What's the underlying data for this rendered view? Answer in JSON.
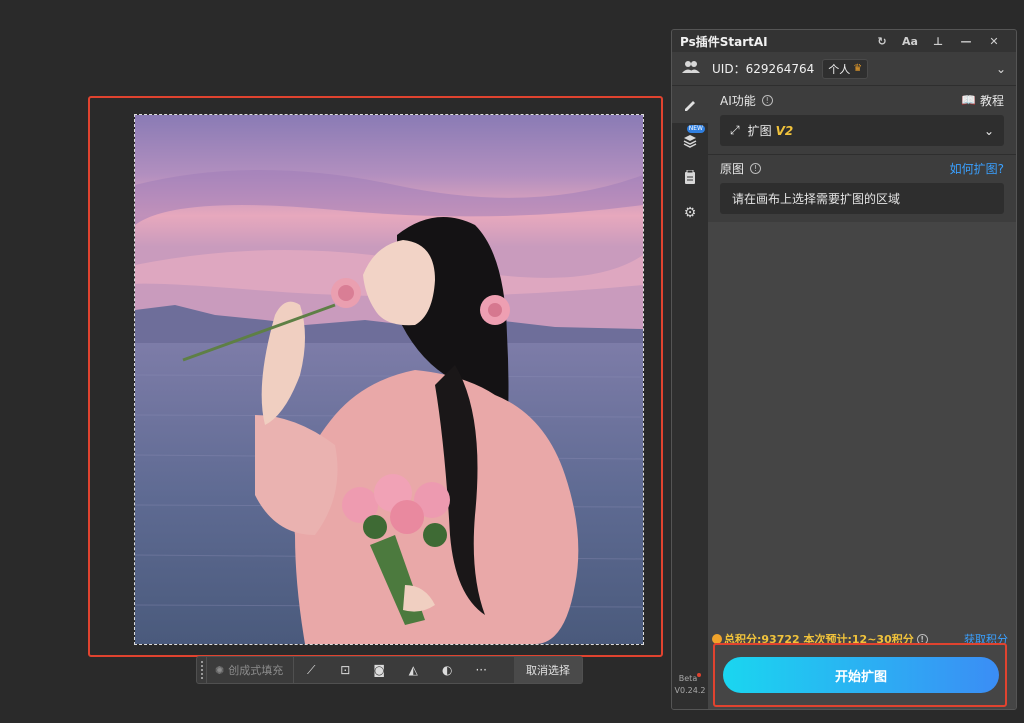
{
  "panel": {
    "title": "Ps插件StartAI",
    "titlebar_buttons": [
      {
        "name": "refresh-icon",
        "glyph": "↻"
      },
      {
        "name": "font-size-icon",
        "glyph": "Aa"
      },
      {
        "name": "pin-icon",
        "glyph": "📌"
      },
      {
        "name": "minimize-icon",
        "glyph": "—"
      },
      {
        "name": "close-icon",
        "glyph": "✕"
      }
    ],
    "user": {
      "uid_text": "UID：629264764",
      "plan_label": "个人"
    },
    "sidebar": {
      "items": [
        {
          "name": "edit-icon",
          "new": false
        },
        {
          "name": "layers-icon",
          "new": true
        },
        {
          "name": "clipboard-icon",
          "new": false
        },
        {
          "name": "settings-gear-icon",
          "new": false
        }
      ],
      "new_badge": "NEW",
      "beta_label": "Beta",
      "version": "V0.24.2"
    },
    "ai_function": {
      "label": "AI功能",
      "tutorial_label": "教程",
      "selected": "扩图",
      "selected_version": "V2"
    },
    "source_image": {
      "label": "原图",
      "help_link": "如何扩图?",
      "hint": "请在画布上选择需要扩图的区域"
    },
    "points": {
      "text": "总积分:93722  本次预计:12~30积分",
      "get_label": "获取积分"
    },
    "start_button": "开始扩图"
  },
  "context_bar": {
    "generative_fill": "创成式填充",
    "deselect": "取消选择"
  },
  "colors": {
    "highlight": "#e0432f",
    "accent_blue": "#3aa0ff",
    "gold": "#f0c23b",
    "button_gradient_start": "#1ad6f0",
    "button_gradient_end": "#3b8df5",
    "arrow": "#f2c21a"
  }
}
